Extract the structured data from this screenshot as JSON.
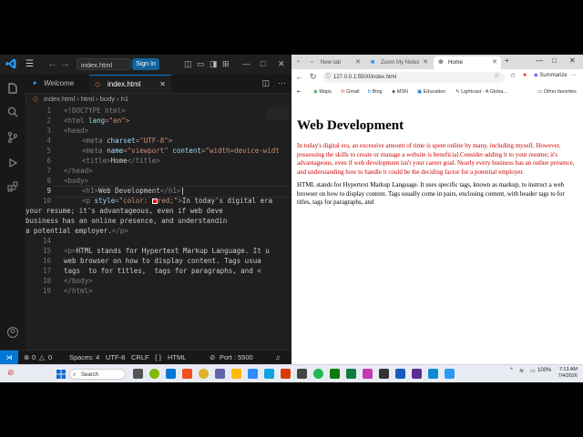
{
  "vscode": {
    "search_text": "index.html",
    "signin_label": "Sign In",
    "tabs": [
      {
        "label": "Welcome"
      },
      {
        "label": "index.html"
      }
    ],
    "breadcrumb": [
      "index.html",
      "html",
      "body",
      "h1"
    ],
    "line_numbers": [
      "1",
      "2",
      "3",
      "4",
      "5",
      "6",
      "7",
      "8",
      "9",
      "10",
      "",
      "",
      "",
      "14",
      "15",
      "16",
      "17",
      "18",
      "19"
    ],
    "code": {
      "l1": "<!DOCTYPE html>",
      "l2a": "<html ",
      "l2b": "lang",
      "l2c": "=\"en\">",
      "l3": "<head>",
      "l4a": "<meta ",
      "l4b": "charset",
      "l4c": "=\"UTF-8\">",
      "l5a": "<meta ",
      "l5b": "name",
      "l5c": "=\"viewport\" ",
      "l5d": "content",
      "l5e": "=\"width=device-widt",
      "l6a": "<title>",
      "l6b": "Home",
      "l6c": "</title>",
      "l7": "</head>",
      "l8": "<body>",
      "l9a": "<h1>",
      "l9b": "Web Development",
      "l9c": "</h1>",
      "l10a": "<p ",
      "l10b": "style",
      "l10c": "=\"color: ",
      "l10d": "red;\">",
      "l10e": "In today's digital era",
      "l11": "your resume; it's advantageous, even if web deve",
      "l12": "business has an online presence, and understandin",
      "l13a": "a potential employer.",
      "l13b": "</p>",
      "l15a": "<p>",
      "l15b": "HTML stands for Hypertext Markup Language. It u",
      "l16": "web browser on how to display content. Tags usua",
      "l17": "tags  to for titles,  tags for paragraphs, and < ",
      "l18": "</body>",
      "l19": "</html>"
    },
    "status": {
      "errors": "0",
      "warnings": "0",
      "spaces": "Spaces: 4",
      "encoding": "UTF-8",
      "eol": "CRLF",
      "language": "HTML",
      "port": "Port : 5500"
    }
  },
  "browser": {
    "tabs": [
      {
        "label": "New tab"
      },
      {
        "label": "Zoom My Notes"
      },
      {
        "label": "Home"
      }
    ],
    "url": "127.0.0.1:5500/index.html",
    "summarize_label": "Summarize",
    "favorites": [
      "Maps",
      "Gmail",
      "Bing",
      "MSN",
      "Education",
      "Lightcast - A Globa...",
      "Other favorites"
    ],
    "page": {
      "heading": "Web Development",
      "para1": "In today's digital era, an excessive amount of time is spent online by many, including myself. However, possessing the skills to create or manage a website is beneficial.Consider adding it to your resume; it's advantageous, even if web development isn't your career goal. Nearly every business has an online presence, and understanding how to handle it could be the deciding factor for a potential employer.",
      "para2": "HTML stands for Hypertext Markup Language. It uses specific tags, known as markup, to instruct a web browser on how to display content. Tags usually come in pairs, enclosing content, with header tags to for titles, tags for paragraphs, and",
      "para1_color": "#cc0000"
    }
  },
  "taskbar": {
    "search_label": "Search",
    "battery": "100%",
    "time": "7:13 AM",
    "date": "7/4/2026"
  },
  "colors": {
    "vscode_bg": "#1f1f1f",
    "accent": "#0078d4",
    "tag": "#569cd6",
    "attr": "#9cdcfe",
    "string": "#ce9178"
  }
}
